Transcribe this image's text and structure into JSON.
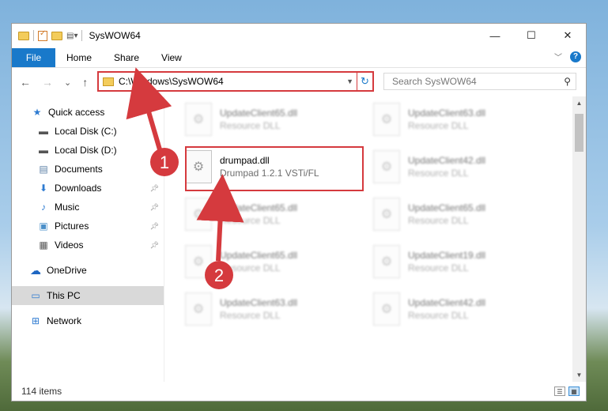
{
  "window": {
    "title": "SysWOW64",
    "controls": {
      "minimize": "—",
      "maximize": "☐",
      "close": "✕"
    }
  },
  "ribbon": {
    "tabs": [
      "File",
      "Home",
      "Share",
      "View"
    ],
    "expand": "﹀",
    "help": "?"
  },
  "nav": {
    "back": "←",
    "forward": "→",
    "recent": "⌄",
    "up": "↑",
    "address": "C:\\Windows\\SysWOW64",
    "refresh": "↻",
    "search_placeholder": "Search SysWOW64"
  },
  "sidebar": {
    "items": [
      {
        "label": "Quick access",
        "icon": "star-icon",
        "glyph": "★",
        "color": "#2e7bd1"
      },
      {
        "label": "Local Disk (C:)",
        "icon": "drive-icon",
        "glyph": "▬",
        "color": "#555555"
      },
      {
        "label": "Local Disk (D:)",
        "icon": "drive-icon",
        "glyph": "▬",
        "color": "#555555"
      },
      {
        "label": "Documents",
        "icon": "documents-icon",
        "glyph": "▤",
        "color": "#5b7fa6"
      },
      {
        "label": "Downloads",
        "icon": "download-icon",
        "glyph": "⬇",
        "color": "#2e7bd1"
      },
      {
        "label": "Music",
        "icon": "music-icon",
        "glyph": "♪",
        "color": "#2e7bd1"
      },
      {
        "label": "Pictures",
        "icon": "pictures-icon",
        "glyph": "▣",
        "color": "#4a8fc9"
      },
      {
        "label": "Videos",
        "icon": "videos-icon",
        "glyph": "▦",
        "color": "#555555"
      },
      {
        "label": "OneDrive",
        "icon": "cloud-icon",
        "glyph": "☁",
        "color": "#1d66c2"
      },
      {
        "label": "This PC",
        "icon": "computer-icon",
        "glyph": "▭",
        "color": "#2e7bd1"
      },
      {
        "label": "Network",
        "icon": "network-icon",
        "glyph": "⊞",
        "color": "#2e7bd1"
      }
    ]
  },
  "files": {
    "left": [
      {
        "name": "UpdateClient65.dll",
        "desc": "Resource DLL"
      },
      {
        "name": "drumpad.dll",
        "desc": "Drumpad 1.2.1 VSTi/FL"
      },
      {
        "name": "UpdateClient65.dll",
        "desc": "Resource DLL"
      },
      {
        "name": "UpdateClient65.dll",
        "desc": "Resource DLL"
      },
      {
        "name": "UpdateClient63.dll",
        "desc": "Resource DLL"
      }
    ],
    "right": [
      {
        "name": "UpdateClient63.dll",
        "desc": "Resource DLL"
      },
      {
        "name": "UpdateClient42.dll",
        "desc": "Resource DLL"
      },
      {
        "name": "UpdateClient65.dll",
        "desc": "Resource DLL"
      },
      {
        "name": "UpdateClient19.dll",
        "desc": "Resource DLL"
      },
      {
        "name": "UpdateClient42.dll",
        "desc": "Resource DLL"
      }
    ]
  },
  "status": {
    "count": "114 items"
  },
  "annotations": {
    "step1": "1",
    "step2": "2",
    "color": "#d53a3e"
  }
}
